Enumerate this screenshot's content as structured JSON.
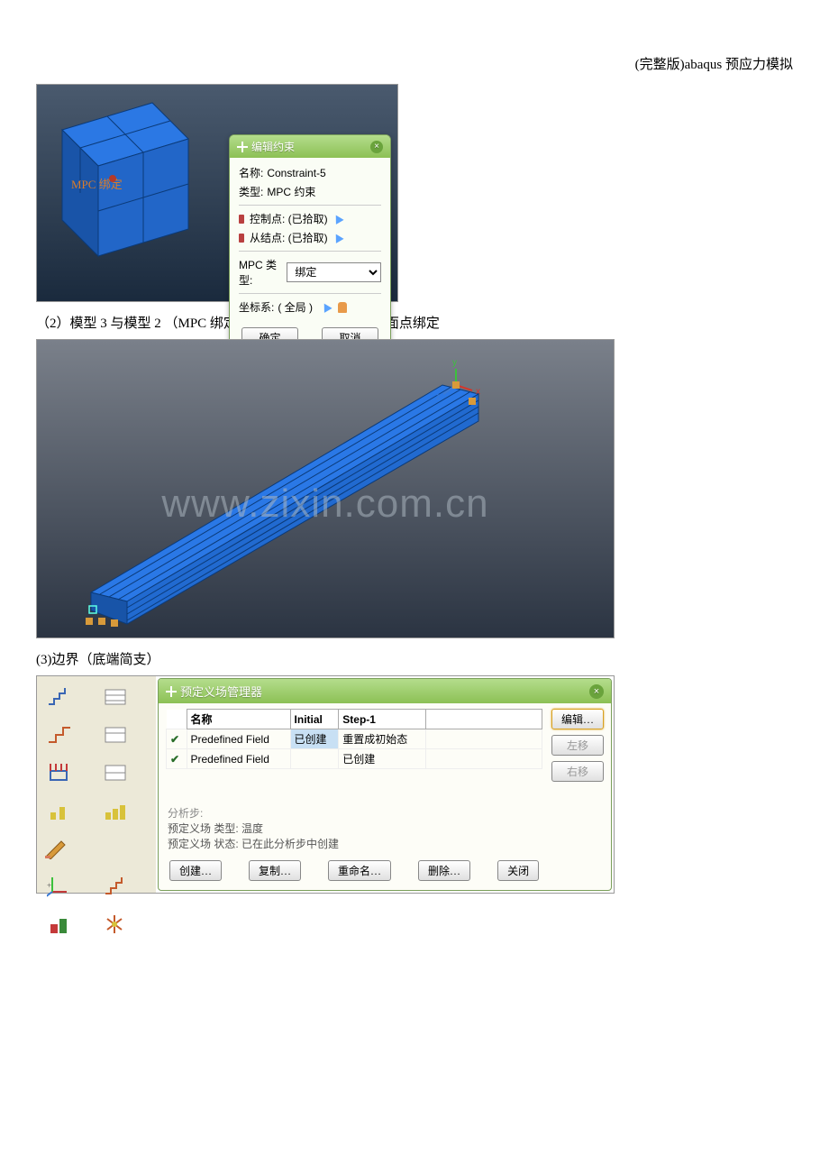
{
  "header": {
    "title": "(完整版)abaqus 预应力模拟"
  },
  "constraint_dialog": {
    "title": "编辑约束",
    "name_label": "名称:",
    "name_value": "Constraint-5",
    "type_label": "类型:",
    "type_value": "MPC 约束",
    "ctrl_point": "控制点: (已拾取)",
    "slave_point": "从结点: (已拾取)",
    "mpc_type_label": "MPC 类型:",
    "mpc_type_value": "绑定",
    "csys_label": "坐标系:",
    "csys_value": "( 全局 )",
    "ok": "确定",
    "cancel": "取消"
  },
  "vp1_label": "MPC 绑定",
  "caption2": "（2）模型 3 与模型 2 （MPC 绑定）线的端点与模型 3 的外面点绑定",
  "watermark": "www.zixin.com.cn",
  "caption3": "(3)边界（底端简支）",
  "manager": {
    "title": "预定义场管理器",
    "col_name": "名称",
    "col_initial": "Initial",
    "col_step1": "Step-1",
    "rows": [
      {
        "name": "Predefined Field",
        "initial": "已创建",
        "step1": "重置成初始态"
      },
      {
        "name": "Predefined Field",
        "initial": "",
        "step1": "已创建"
      }
    ],
    "edit": "编辑…",
    "left": "左移",
    "right": "右移",
    "analysis_step_label": "分析步:",
    "analysis_step_value": "",
    "field_type_label": "预定义场 类型:",
    "field_type_value": "温度",
    "field_state_label": "预定义场 状态:",
    "field_state_value": "已在此分析步中创建",
    "create": "创建…",
    "copy": "复制…",
    "rename": "重命名…",
    "delete": "删除…",
    "close": "关闭"
  }
}
